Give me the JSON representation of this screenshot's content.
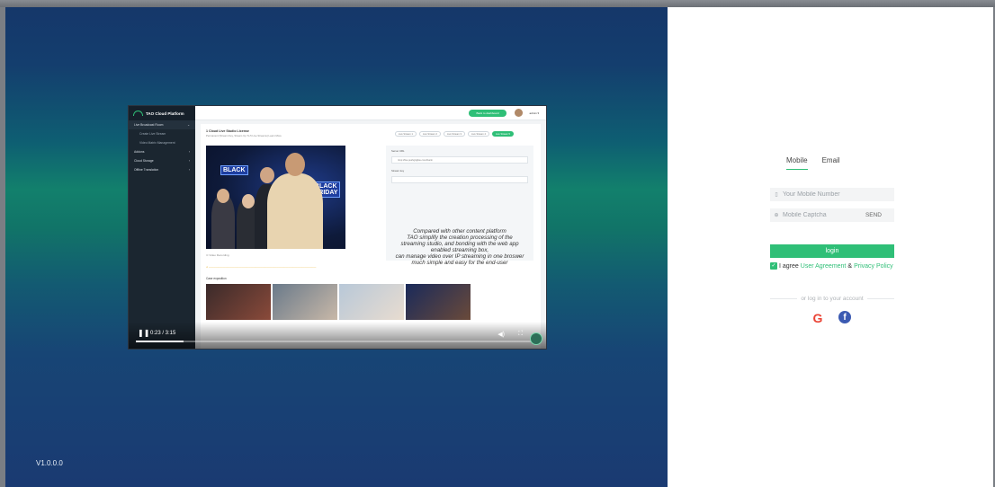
{
  "version": "V1.0.0.0",
  "player": {
    "time": "0:23 / 3:15",
    "progress_fraction": 0.118,
    "app": {
      "logo": "TAO  Cloud Platform",
      "nav": [
        {
          "label": "Live Broadcast Room",
          "active": true
        },
        {
          "label": "Create Live Stream",
          "sub": true
        },
        {
          "label": "Video Matrix Management",
          "sub": true
        },
        {
          "label": "Addons"
        },
        {
          "label": "Cloud Storage"
        },
        {
          "label": "Offline Translation"
        }
      ],
      "dashboard_button": "Back to dashboard",
      "admin": "admin",
      "license_title": "1 Cloud Live Studio License",
      "license_sub": "Permanent (Stream Key, Stream Up To 5 Live Streams)  Learn More",
      "stream_tabs": [
        "Live Stream 1",
        "Live Stream 2",
        "Live Stream 3",
        "Live Stream 4",
        "Live Stream 5"
      ],
      "server_url_label": "Server URL",
      "server_url": "rtmp://live.pushgrigliou.com/live/in",
      "stream_key_label": "Stream key",
      "tagline": [
        "Compared with other content platform",
        "TAO simplify the creation processing of the",
        "streaming studio, and bonding with the web app",
        "enabled streaming box,",
        "can manage video over IP streaming in one broswer",
        "much simple and easy for the end-user"
      ],
      "video_recording": "Video Recording",
      "cases_title": "Case exposition",
      "billboard": [
        "BLACK",
        "FRIDAY"
      ]
    }
  },
  "login": {
    "tab_mobile": "Mobile",
    "tab_email": "Email",
    "mobile_placeholder": "Your Mobile Number",
    "captcha_placeholder": "Mobile Captcha",
    "send": "SEND",
    "login_button": "login",
    "agree_prefix": "I agree",
    "user_agreement": "User Agreement",
    "and": "&",
    "privacy_policy": "Privacy Policy",
    "or_text": "or log in to your account",
    "google_letter": "G",
    "facebook_letter": "f"
  },
  "colors": {
    "accent": "#2fbf77",
    "left_panel_top": "#15376a",
    "left_panel_mid": "#12806c"
  }
}
